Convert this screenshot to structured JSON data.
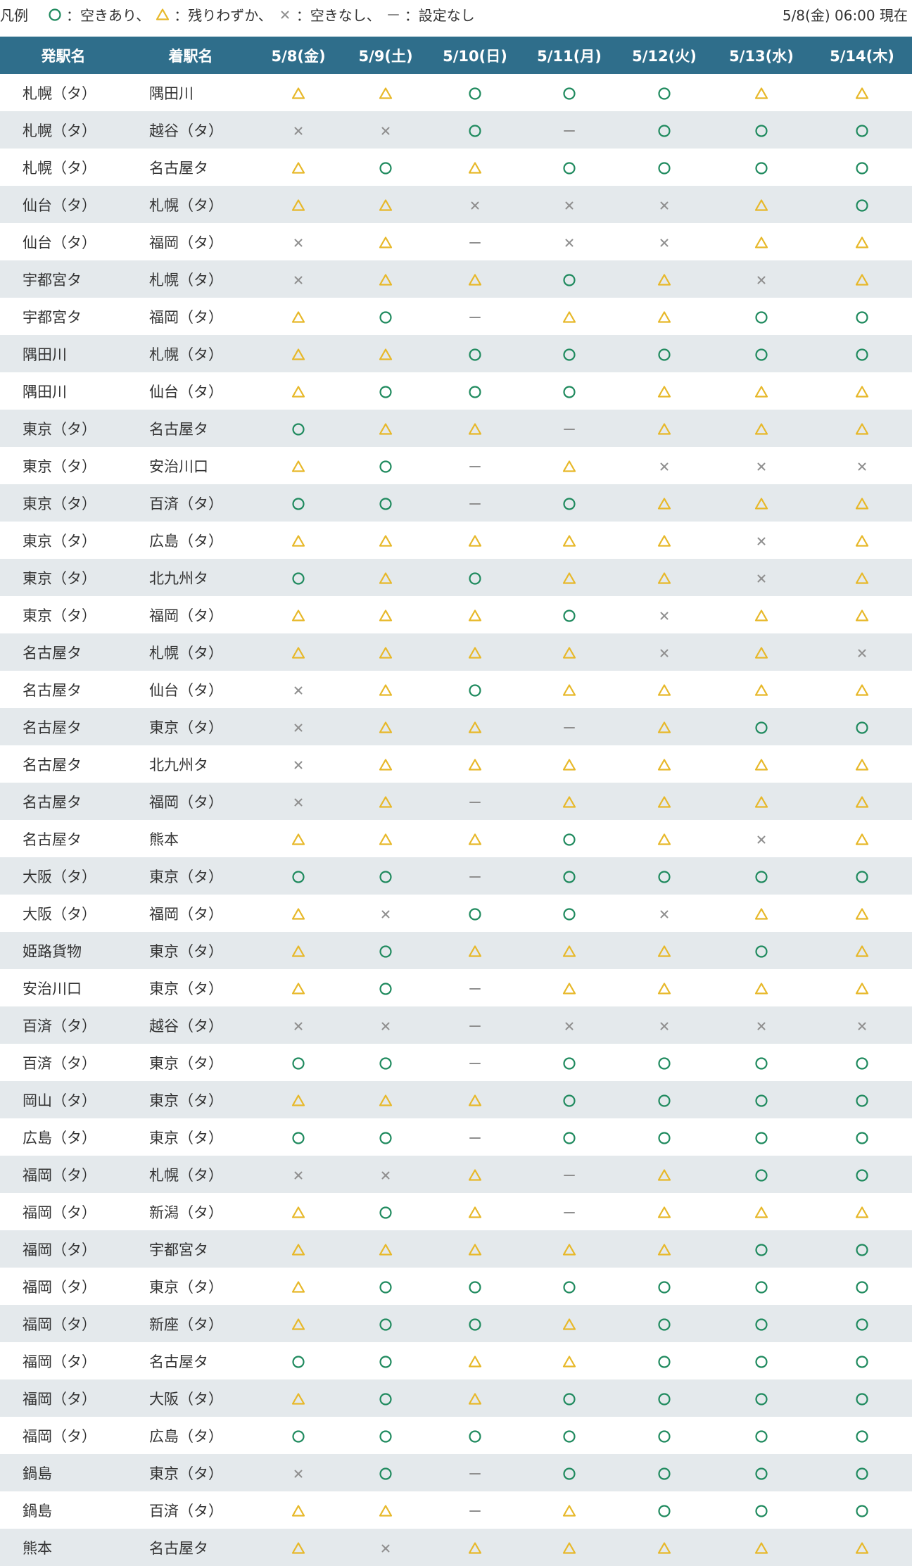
{
  "legend": {
    "title": "凡例",
    "items": [
      {
        "symbol": "circle",
        "text": "：空きあり、"
      },
      {
        "symbol": "triangle",
        "text": "：残りわずか、"
      },
      {
        "symbol": "cross",
        "text": "：空きなし、"
      },
      {
        "symbol": "dash",
        "text": "：設定なし"
      }
    ]
  },
  "timestamp": "5/8(金) 06:00 現在",
  "colors": {
    "header_bg": "#2f6e8b",
    "row_alt": "#e4e9ec",
    "circle": "#1f8a5e",
    "triangle": "#e7b829",
    "cross": "#8f8f8f",
    "dash": "#8f8f8f"
  },
  "table": {
    "headers": [
      "発駅名",
      "着駅名",
      "5/8(金)",
      "5/9(土)",
      "5/10(日)",
      "5/11(月)",
      "5/12(火)",
      "5/13(水)",
      "5/14(木)"
    ],
    "rows": [
      {
        "from": "札幌（タ）",
        "to": "隅田川",
        "status": [
          "△",
          "△",
          "○",
          "○",
          "○",
          "△",
          "△"
        ]
      },
      {
        "from": "札幌（タ）",
        "to": "越谷（タ）",
        "status": [
          "×",
          "×",
          "○",
          "—",
          "○",
          "○",
          "○"
        ]
      },
      {
        "from": "札幌（タ）",
        "to": "名古屋タ",
        "status": [
          "△",
          "○",
          "△",
          "○",
          "○",
          "○",
          "○"
        ]
      },
      {
        "from": "仙台（タ）",
        "to": "札幌（タ）",
        "status": [
          "△",
          "△",
          "×",
          "×",
          "×",
          "△",
          "○"
        ]
      },
      {
        "from": "仙台（タ）",
        "to": "福岡（タ）",
        "status": [
          "×",
          "△",
          "—",
          "×",
          "×",
          "△",
          "△"
        ]
      },
      {
        "from": "宇都宮タ",
        "to": "札幌（タ）",
        "status": [
          "×",
          "△",
          "△",
          "○",
          "△",
          "×",
          "△"
        ]
      },
      {
        "from": "宇都宮タ",
        "to": "福岡（タ）",
        "status": [
          "△",
          "○",
          "—",
          "△",
          "△",
          "○",
          "○"
        ]
      },
      {
        "from": "隅田川",
        "to": "札幌（タ）",
        "status": [
          "△",
          "△",
          "○",
          "○",
          "○",
          "○",
          "○"
        ]
      },
      {
        "from": "隅田川",
        "to": "仙台（タ）",
        "status": [
          "△",
          "○",
          "○",
          "○",
          "△",
          "△",
          "△"
        ]
      },
      {
        "from": "東京（タ）",
        "to": "名古屋タ",
        "status": [
          "○",
          "△",
          "△",
          "—",
          "△",
          "△",
          "△"
        ]
      },
      {
        "from": "東京（タ）",
        "to": "安治川口",
        "status": [
          "△",
          "○",
          "—",
          "△",
          "×",
          "×",
          "×"
        ]
      },
      {
        "from": "東京（タ）",
        "to": "百済（タ）",
        "status": [
          "○",
          "○",
          "—",
          "○",
          "△",
          "△",
          "△"
        ]
      },
      {
        "from": "東京（タ）",
        "to": "広島（タ）",
        "status": [
          "△",
          "△",
          "△",
          "△",
          "△",
          "×",
          "△"
        ]
      },
      {
        "from": "東京（タ）",
        "to": "北九州タ",
        "status": [
          "○",
          "△",
          "○",
          "△",
          "△",
          "×",
          "△"
        ]
      },
      {
        "from": "東京（タ）",
        "to": "福岡（タ）",
        "status": [
          "△",
          "△",
          "△",
          "○",
          "×",
          "△",
          "△"
        ]
      },
      {
        "from": "名古屋タ",
        "to": "札幌（タ）",
        "status": [
          "△",
          "△",
          "△",
          "△",
          "×",
          "△",
          "×"
        ]
      },
      {
        "from": "名古屋タ",
        "to": "仙台（タ）",
        "status": [
          "×",
          "△",
          "○",
          "△",
          "△",
          "△",
          "△"
        ]
      },
      {
        "from": "名古屋タ",
        "to": "東京（タ）",
        "status": [
          "×",
          "△",
          "△",
          "—",
          "△",
          "○",
          "○"
        ]
      },
      {
        "from": "名古屋タ",
        "to": "北九州タ",
        "status": [
          "×",
          "△",
          "△",
          "△",
          "△",
          "△",
          "△"
        ]
      },
      {
        "from": "名古屋タ",
        "to": "福岡（タ）",
        "status": [
          "×",
          "△",
          "—",
          "△",
          "△",
          "△",
          "△"
        ]
      },
      {
        "from": "名古屋タ",
        "to": "熊本",
        "status": [
          "△",
          "△",
          "△",
          "○",
          "△",
          "×",
          "△"
        ]
      },
      {
        "from": "大阪（タ）",
        "to": "東京（タ）",
        "status": [
          "○",
          "○",
          "—",
          "○",
          "○",
          "○",
          "○"
        ]
      },
      {
        "from": "大阪（タ）",
        "to": "福岡（タ）",
        "status": [
          "△",
          "×",
          "○",
          "○",
          "×",
          "△",
          "△"
        ]
      },
      {
        "from": "姫路貨物",
        "to": "東京（タ）",
        "status": [
          "△",
          "○",
          "△",
          "△",
          "△",
          "○",
          "△"
        ]
      },
      {
        "from": "安治川口",
        "to": "東京（タ）",
        "status": [
          "△",
          "○",
          "—",
          "△",
          "△",
          "△",
          "△"
        ]
      },
      {
        "from": "百済（タ）",
        "to": "越谷（タ）",
        "status": [
          "×",
          "×",
          "—",
          "×",
          "×",
          "×",
          "×"
        ]
      },
      {
        "from": "百済（タ）",
        "to": "東京（タ）",
        "status": [
          "○",
          "○",
          "—",
          "○",
          "○",
          "○",
          "○"
        ]
      },
      {
        "from": "岡山（タ）",
        "to": "東京（タ）",
        "status": [
          "△",
          "△",
          "△",
          "○",
          "○",
          "○",
          "○"
        ]
      },
      {
        "from": "広島（タ）",
        "to": "東京（タ）",
        "status": [
          "○",
          "○",
          "—",
          "○",
          "○",
          "○",
          "○"
        ]
      },
      {
        "from": "福岡（タ）",
        "to": "札幌（タ）",
        "status": [
          "×",
          "×",
          "△",
          "—",
          "△",
          "○",
          "○"
        ]
      },
      {
        "from": "福岡（タ）",
        "to": "新潟（タ）",
        "status": [
          "△",
          "○",
          "△",
          "—",
          "△",
          "△",
          "△"
        ]
      },
      {
        "from": "福岡（タ）",
        "to": "宇都宮タ",
        "status": [
          "△",
          "△",
          "△",
          "△",
          "△",
          "○",
          "○"
        ]
      },
      {
        "from": "福岡（タ）",
        "to": "東京（タ）",
        "status": [
          "△",
          "○",
          "○",
          "○",
          "○",
          "○",
          "○"
        ]
      },
      {
        "from": "福岡（タ）",
        "to": "新座（タ）",
        "status": [
          "△",
          "○",
          "○",
          "△",
          "○",
          "○",
          "○"
        ]
      },
      {
        "from": "福岡（タ）",
        "to": "名古屋タ",
        "status": [
          "○",
          "○",
          "△",
          "△",
          "○",
          "○",
          "○"
        ]
      },
      {
        "from": "福岡（タ）",
        "to": "大阪（タ）",
        "status": [
          "△",
          "○",
          "△",
          "○",
          "○",
          "○",
          "○"
        ]
      },
      {
        "from": "福岡（タ）",
        "to": "広島（タ）",
        "status": [
          "○",
          "○",
          "○",
          "○",
          "○",
          "○",
          "○"
        ]
      },
      {
        "from": "鍋島",
        "to": "東京（タ）",
        "status": [
          "×",
          "○",
          "—",
          "○",
          "○",
          "○",
          "○"
        ]
      },
      {
        "from": "鍋島",
        "to": "百済（タ）",
        "status": [
          "△",
          "△",
          "—",
          "△",
          "○",
          "○",
          "○"
        ]
      },
      {
        "from": "熊本",
        "to": "名古屋タ",
        "status": [
          "△",
          "×",
          "△",
          "△",
          "△",
          "△",
          "△"
        ]
      }
    ]
  }
}
